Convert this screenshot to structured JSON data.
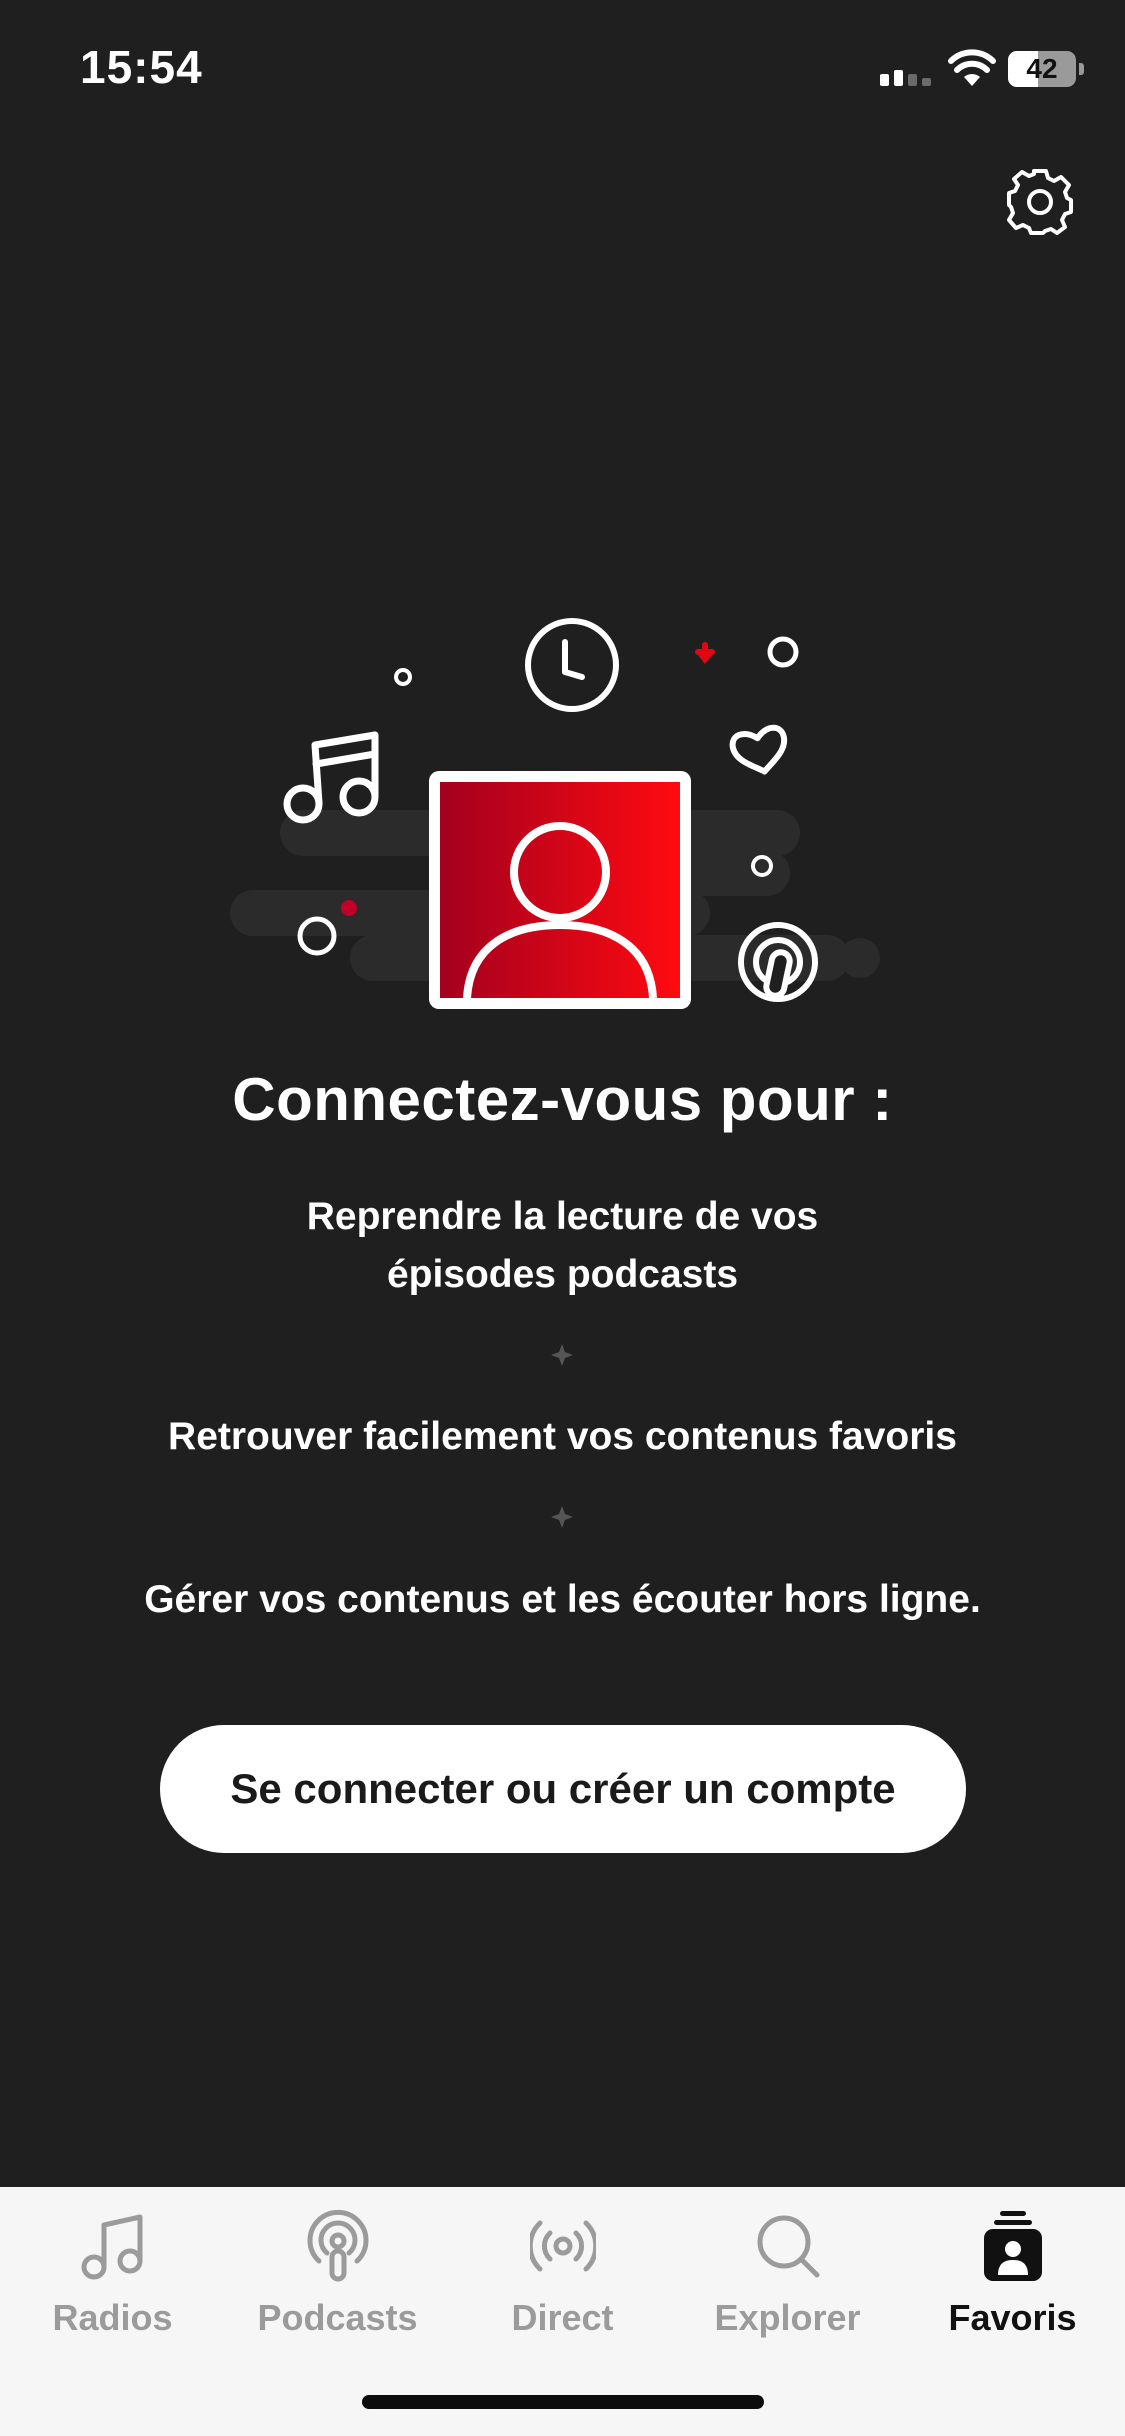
{
  "status_bar": {
    "time": "15:54",
    "battery": "42"
  },
  "main": {
    "headline": "Connectez-vous pour :",
    "benefits": [
      {
        "line1": "Reprendre la lecture de vos",
        "line2": "épisodes podcasts"
      },
      {
        "line1": "Retrouver facilement vos contenus favoris"
      },
      {
        "line1": "Gérer vos contenus et les écouter hors ligne."
      }
    ],
    "login_button": "Se connecter ou créer un compte"
  },
  "tab_bar": {
    "tabs": [
      {
        "label": "Radios",
        "icon": "music-note-icon",
        "active": false
      },
      {
        "label": "Podcasts",
        "icon": "podcast-icon",
        "active": false
      },
      {
        "label": "Direct",
        "icon": "broadcast-icon",
        "active": false
      },
      {
        "label": "Explorer",
        "icon": "search-icon",
        "active": false
      },
      {
        "label": "Favoris",
        "icon": "favorites-user-icon",
        "active": true
      }
    ]
  },
  "colors": {
    "background": "#1f1f1f",
    "accent_red": "#e10613",
    "tab_bar_bg": "#f6f6f6",
    "tab_inactive": "#9b9b9b",
    "tab_active": "#111111"
  }
}
